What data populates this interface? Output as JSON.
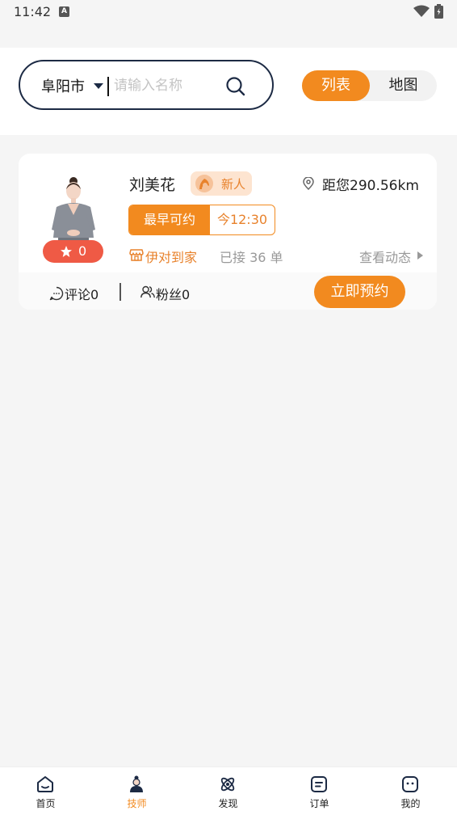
{
  "status_bar": {
    "time": "11:42",
    "notif": "A"
  },
  "search": {
    "city": "阜阳市",
    "placeholder": "请输入名称"
  },
  "view_toggle": {
    "list_label": "列表",
    "map_label": "地图",
    "active": "list"
  },
  "therapist": {
    "name": "刘美花",
    "badge": "新人",
    "distance": "距您290.56km",
    "rating": "0",
    "availability_label": "最早可约",
    "availability_time": "今12:30",
    "shop": "伊对到家",
    "orders": "已接 36 单",
    "view_dynamic": "查看动态",
    "comments": "评论0",
    "fans": "粉丝0",
    "book_label": "立即预约"
  },
  "tabbar": [
    {
      "label": "首页",
      "icon": "home-icon"
    },
    {
      "label": "技师",
      "icon": "therapist-icon",
      "active": true
    },
    {
      "label": "发现",
      "icon": "discover-icon"
    },
    {
      "label": "订单",
      "icon": "orders-icon"
    },
    {
      "label": "我的",
      "icon": "profile-icon"
    }
  ],
  "colors": {
    "accent": "#f28a1f",
    "rating_bg": "#ef5a45",
    "search_border": "#1c2a44"
  }
}
